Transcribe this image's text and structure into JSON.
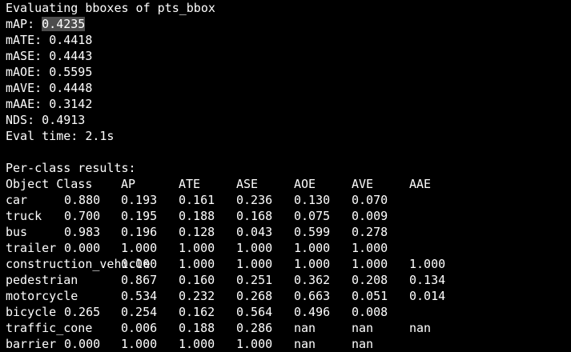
{
  "header": "Evaluating bboxes of pts_bbox",
  "metrics": [
    {
      "label": "mAP: ",
      "value": "0.4235",
      "highlighted": true
    },
    {
      "label": "mATE: ",
      "value": "0.4418",
      "highlighted": false
    },
    {
      "label": "mASE: ",
      "value": "0.4443",
      "highlighted": false
    },
    {
      "label": "mAOE: ",
      "value": "0.5595",
      "highlighted": false
    },
    {
      "label": "mAVE: ",
      "value": "0.4448",
      "highlighted": false
    },
    {
      "label": "mAAE: ",
      "value": "0.3142",
      "highlighted": false
    },
    {
      "label": "NDS: ",
      "value": "0.4913",
      "highlighted": false
    },
    {
      "label": "Eval time: ",
      "value": "2.1s",
      "highlighted": false
    }
  ],
  "per_class_title": "Per-class results:",
  "table": {
    "headers": [
      "Object Class",
      "AP",
      "ATE",
      "ASE",
      "AOE",
      "AVE",
      "AAE"
    ],
    "rows": [
      {
        "cls": "car",
        "vals": [
          "0.880",
          "0.193",
          "0.161",
          "0.236",
          "0.130",
          "0.070"
        ]
      },
      {
        "cls": "truck",
        "vals": [
          "0.700",
          "0.195",
          "0.188",
          "0.168",
          "0.075",
          "0.009"
        ]
      },
      {
        "cls": "bus",
        "vals": [
          "0.983",
          "0.196",
          "0.128",
          "0.043",
          "0.599",
          "0.278"
        ]
      },
      {
        "cls": "trailer",
        "vals": [
          "0.000",
          "1.000",
          "1.000",
          "1.000",
          "1.000",
          "1.000"
        ]
      },
      {
        "cls": "construction_vehicle",
        "vals": [
          "0.000",
          "1.000",
          "1.000",
          "1.000",
          "1.000",
          "1.000"
        ]
      },
      {
        "cls": "pedestrian",
        "vals": [
          "0.867",
          "0.160",
          "0.251",
          "0.362",
          "0.208",
          "0.134"
        ]
      },
      {
        "cls": "motorcycle",
        "vals": [
          "0.534",
          "0.232",
          "0.268",
          "0.663",
          "0.051",
          "0.014"
        ]
      },
      {
        "cls": "bicycle",
        "vals": [
          "0.265",
          "0.254",
          "0.162",
          "0.564",
          "0.496",
          "0.008"
        ]
      },
      {
        "cls": "traffic_cone",
        "vals": [
          "0.006",
          "0.188",
          "0.286",
          "nan",
          "nan",
          "nan"
        ]
      },
      {
        "cls": "barrier",
        "vals": [
          "0.000",
          "1.000",
          "1.000",
          "1.000",
          "nan",
          "nan"
        ]
      }
    ]
  },
  "colors": {
    "background": "#000000",
    "text": "#ffffff",
    "selection": "#4d4d4d"
  }
}
